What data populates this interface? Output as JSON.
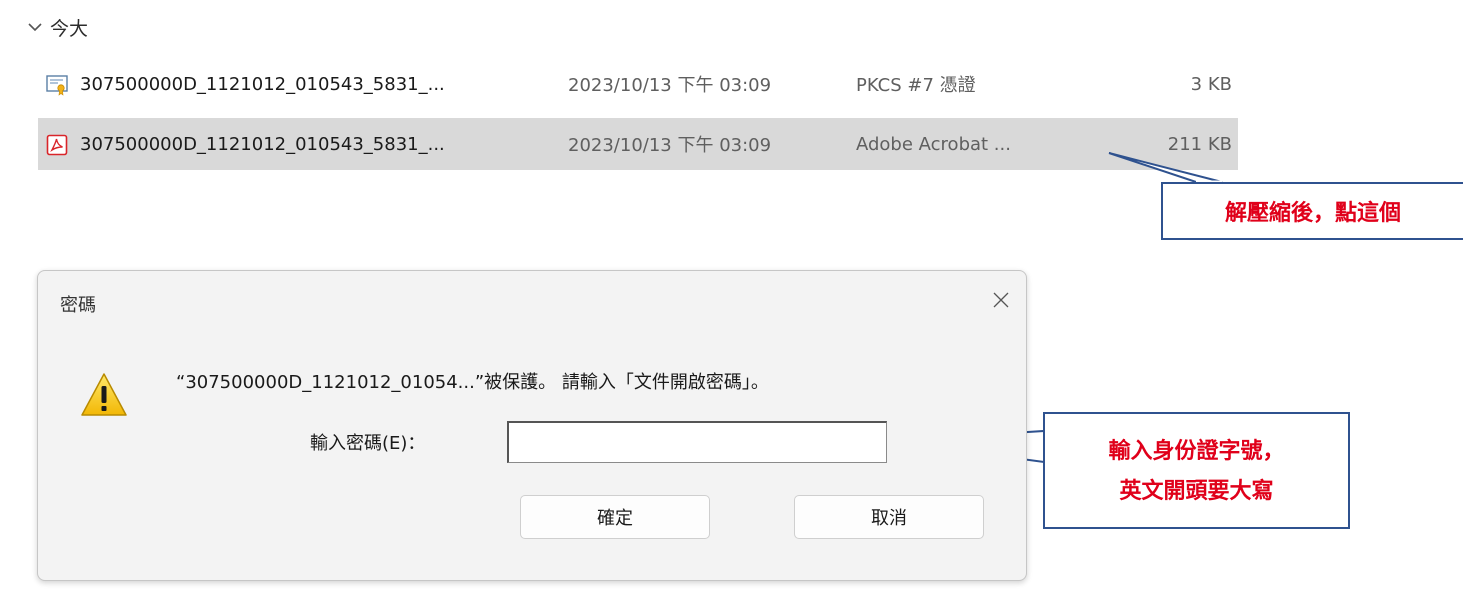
{
  "group": {
    "title": "今大",
    "icon": "chevron-down-icon"
  },
  "files": [
    {
      "icon": "certificate-icon",
      "name": "307500000D_1121012_010543_5831_...",
      "date": "2023/10/13 下午 03:09",
      "type": "PKCS #7 憑證",
      "size": "3 KB",
      "selected": false
    },
    {
      "icon": "pdf-icon",
      "name": "307500000D_1121012_010543_5831_...",
      "date": "2023/10/13 下午 03:09",
      "type": "Adobe Acrobat ...",
      "size": "211 KB",
      "selected": true
    }
  ],
  "annotations": {
    "callout1": "解壓縮後，點這個",
    "callout2_line1": "輸入身份證字號，",
    "callout2_line2": "英文開頭要大寫"
  },
  "dialog": {
    "title": "密碼",
    "message": "“307500000D_1121012_01054...”被保護。 請輸入「文件開啟密碼」。",
    "password_label": "輸入密碼(E)：",
    "password_value": "",
    "ok_label": "確定",
    "cancel_label": "取消"
  },
  "colors": {
    "callout_text": "#e0001a",
    "callout_border": "#2f528f",
    "selection": "#d9d9d9",
    "pdf_red": "#d9252a"
  }
}
